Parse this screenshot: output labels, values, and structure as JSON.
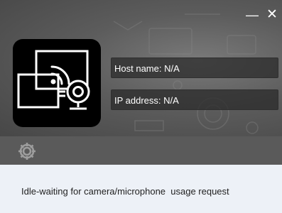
{
  "window": {
    "minimize_icon": "minimize-icon",
    "close_icon": "close-icon",
    "minimize_glyph": "—",
    "close_glyph": "✕"
  },
  "app_icon": "screen-cast-camera-icon",
  "info": {
    "host_name": "Host name: N/A",
    "ip_address": "IP address: N/A"
  },
  "toolbar": {
    "settings_icon": "gear-icon"
  },
  "status": {
    "text": "Idle-waiting for camera/microphone  usage request"
  },
  "colors": {
    "header_background": "#5c5c5c",
    "toolbar_background": "#5a5a5a",
    "status_background": "#edf1f7",
    "icon_accent": "#ffffff"
  }
}
